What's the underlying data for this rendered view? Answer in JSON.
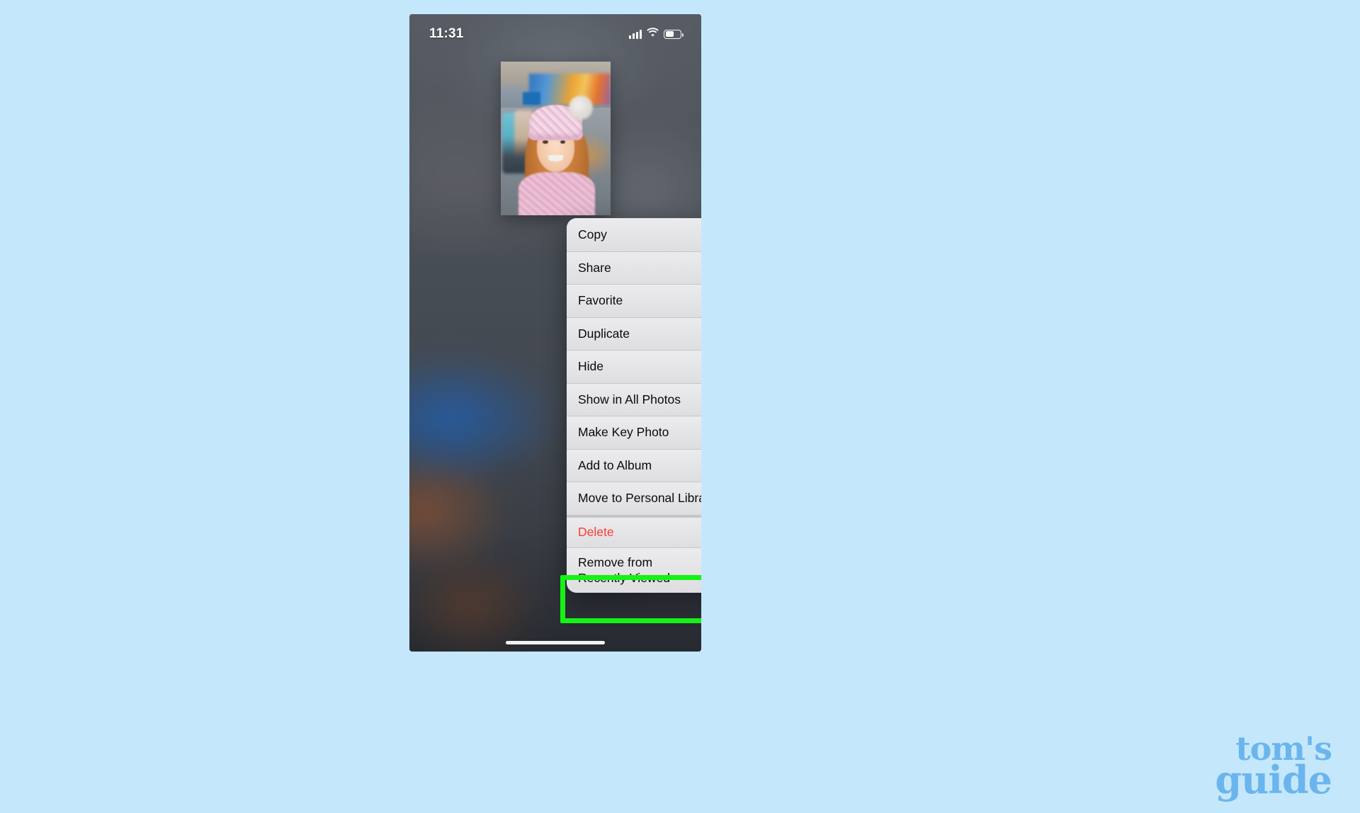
{
  "page": {
    "background_color": "#c4e7fb",
    "watermark": {
      "line1": "tom's",
      "line2": "guide",
      "color": "#6bb5ee"
    }
  },
  "phone": {
    "status_bar": {
      "clock": "11:31",
      "icons": [
        "cellular-signal-icon",
        "wifi-icon",
        "battery-icon"
      ],
      "battery_level_percent": 52
    },
    "photo_preview": {
      "description": "Photo of a smiling girl with long red hair wearing a pink knitted bobble hat"
    },
    "home_indicator": true
  },
  "context_menu": {
    "items": [
      {
        "label": "Copy",
        "icon": "copy-icon",
        "style": "default"
      },
      {
        "label": "Share",
        "icon": "share-icon",
        "style": "default"
      },
      {
        "label": "Favorite",
        "icon": "heart-icon",
        "style": "default"
      },
      {
        "label": "Duplicate",
        "icon": "duplicate-icon",
        "style": "default"
      },
      {
        "label": "Hide",
        "icon": "eye-slash-icon",
        "style": "default"
      },
      {
        "label": "Show in All Photos",
        "icon": "photo-stack-icon",
        "style": "default"
      },
      {
        "label": "Make Key Photo",
        "icon": "photo-icon",
        "style": "default"
      },
      {
        "label": "Add to Album",
        "icon": "add-to-album-icon",
        "style": "default"
      },
      {
        "label": "Move to Personal Library",
        "icon": "person-icon",
        "style": "default"
      },
      {
        "label": "Delete",
        "icon": "trash-icon",
        "style": "destructive"
      },
      {
        "label": "Remove from\nRecently Viewed",
        "icon": "minus-circle-icon",
        "style": "default"
      }
    ]
  },
  "annotation": {
    "highlight_color": "#16f216",
    "highlighted_item": "Remove from Recently Viewed"
  }
}
